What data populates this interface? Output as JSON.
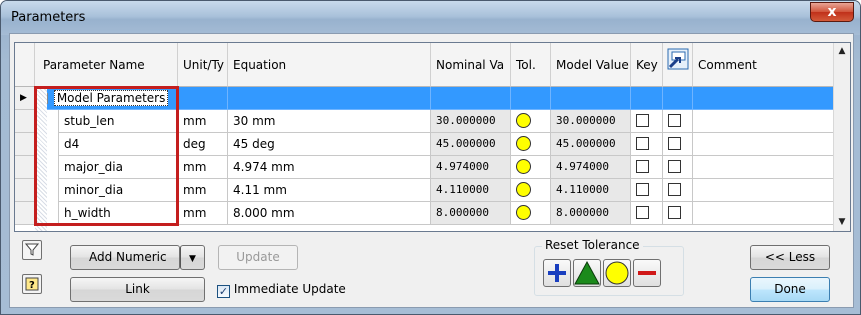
{
  "window": {
    "title": "Parameters",
    "close_glyph": "x"
  },
  "grid": {
    "columns": [
      "Parameter Name",
      "Unit/Ty",
      "Equation",
      "Nominal Va",
      "Tol.",
      "Model Value",
      "Key",
      "",
      "Comment"
    ],
    "group_row": {
      "label": "Model Parameters",
      "expander": "−",
      "pointer": "▶"
    },
    "rows": [
      {
        "name": "stub_len",
        "unit": "mm",
        "equation": "30 mm",
        "nominal": "30.000000",
        "model": "30.000000"
      },
      {
        "name": "d4",
        "unit": "deg",
        "equation": "45 deg",
        "nominal": "45.000000",
        "model": "45.000000"
      },
      {
        "name": "major_dia",
        "unit": "mm",
        "equation": "4.974 mm",
        "nominal": "4.974000",
        "model": "4.974000"
      },
      {
        "name": "minor_dia",
        "unit": "mm",
        "equation": "4.11 mm",
        "nominal": "4.110000",
        "model": "4.110000"
      },
      {
        "name": "h_width",
        "unit": "mm",
        "equation": "8.000 mm",
        "nominal": "8.000000",
        "model": "8.000000"
      }
    ]
  },
  "buttons": {
    "add_numeric": "Add Numeric",
    "update": "Update",
    "link": "Link",
    "less": "<< Less",
    "done": "Done"
  },
  "immediate_update": {
    "label": "Immediate Update",
    "checked": true
  },
  "reset_tolerance": {
    "label": "Reset Tolerance"
  },
  "colors": {
    "selection": "#3399ff",
    "tol_circle": "#ffff00",
    "highlight_box": "#c41e1e"
  }
}
